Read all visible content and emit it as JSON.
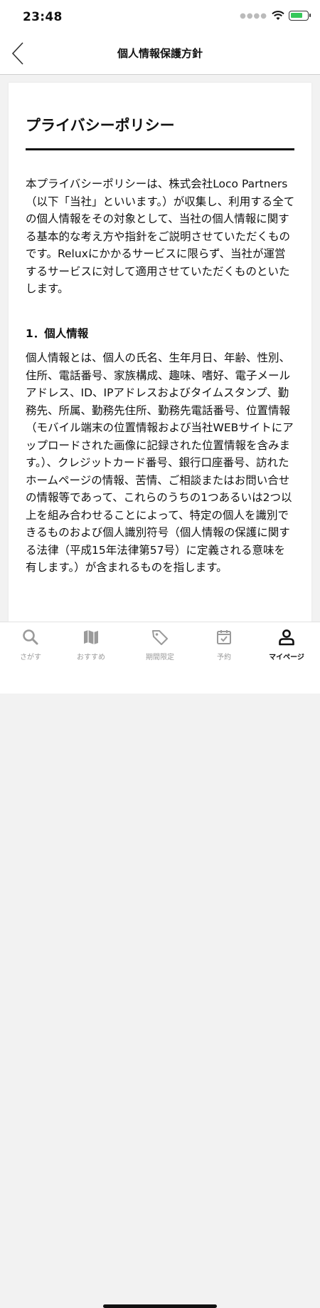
{
  "status_bar": {
    "time": "23:48"
  },
  "nav": {
    "title": "個人情報保護方針"
  },
  "policy": {
    "title": "プライバシーポリシー",
    "intro": "本プライバシーポリシーは、株式会社Loco Partners（以下「当社」といいます。）が収集し、利用する全ての個人情報をその対象として、当社の個人情報に関する基本的な考え方や指針をご説明させていただくものです。Reluxにかかるサービスに限らず、当社が運営するサービスに対して適用させていただくものといたします。",
    "section1_heading": "1．個人情報",
    "section1_body": "個人情報とは、個人の氏名、生年月日、年齢、性別、住所、電話番号、家族構成、趣味、嗜好、電子メールアドレス、ID、IPアドレスおよびタイムスタンプ、勤務先、所属、勤務先住所、勤務先電話番号、位置情報（モバイル端末の位置情報および当社WEBサイトにアップロードされた画像に記録された位置情報を含みます。）、クレジットカード番号、銀行口座番号、訪れたホームページの情報、苦情、ご相談またはお問い合せの情報等であって、これらのうちの1つあるいは2つ以上を組み合わせることによって、特定の個人を識別できるものおよび個人識別符号（個人情報の保護に関する法律（平成15年法律第57号）に定義される意味を有します。）が含まれるものを指します。"
  },
  "tabs": [
    {
      "label": "さがす",
      "icon": "search-icon"
    },
    {
      "label": "おすすめ",
      "icon": "map-icon"
    },
    {
      "label": "期間限定",
      "icon": "tag-icon"
    },
    {
      "label": "予約",
      "icon": "calendar-icon"
    },
    {
      "label": "マイページ",
      "icon": "person-icon",
      "active": true
    }
  ]
}
